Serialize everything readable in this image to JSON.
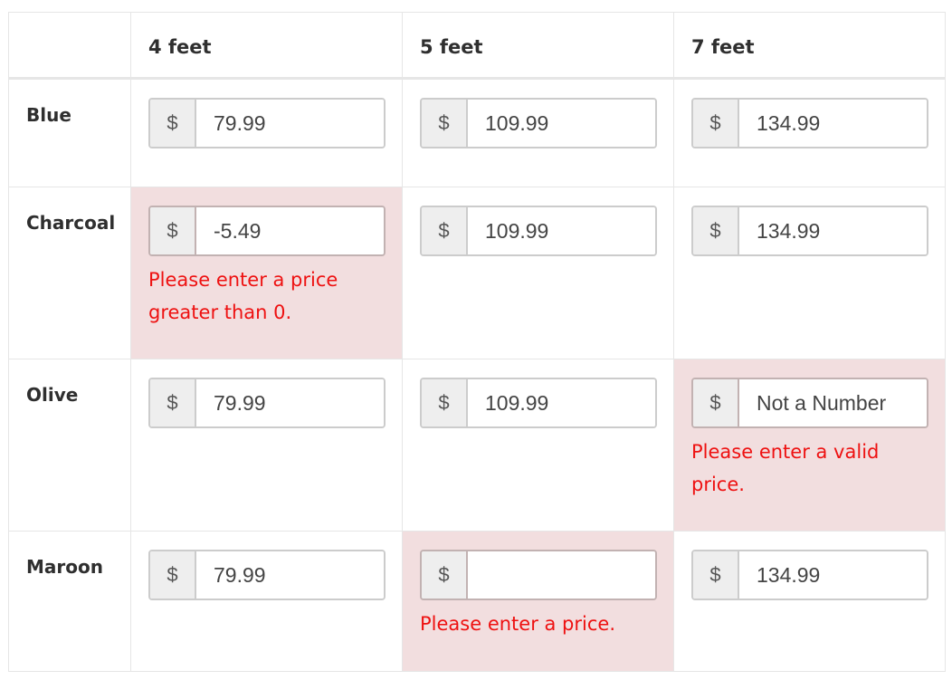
{
  "columns": [
    "",
    "4 feet",
    "5 feet",
    "7 feet"
  ],
  "currency_symbol": "$",
  "rows": [
    {
      "label": "Blue",
      "cells": [
        {
          "value": "79.99",
          "error": ""
        },
        {
          "value": "109.99",
          "error": ""
        },
        {
          "value": "134.99",
          "error": ""
        }
      ]
    },
    {
      "label": "Charcoal",
      "cells": [
        {
          "value": "-5.49",
          "error": "Please enter a price greater than 0."
        },
        {
          "value": "109.99",
          "error": ""
        },
        {
          "value": "134.99",
          "error": ""
        }
      ]
    },
    {
      "label": "Olive",
      "cells": [
        {
          "value": "79.99",
          "error": ""
        },
        {
          "value": "109.99",
          "error": ""
        },
        {
          "value": "Not a Number",
          "error": "Please enter a valid price."
        }
      ]
    },
    {
      "label": "Maroon",
      "cells": [
        {
          "value": "79.99",
          "error": ""
        },
        {
          "value": "",
          "error": "Please enter a price."
        },
        {
          "value": "134.99",
          "error": ""
        }
      ]
    }
  ],
  "colors": {
    "error_background": "#f2dedf",
    "error_text": "#ee1111",
    "addon_background": "#eeeeee",
    "border": "#e6e6e6"
  }
}
